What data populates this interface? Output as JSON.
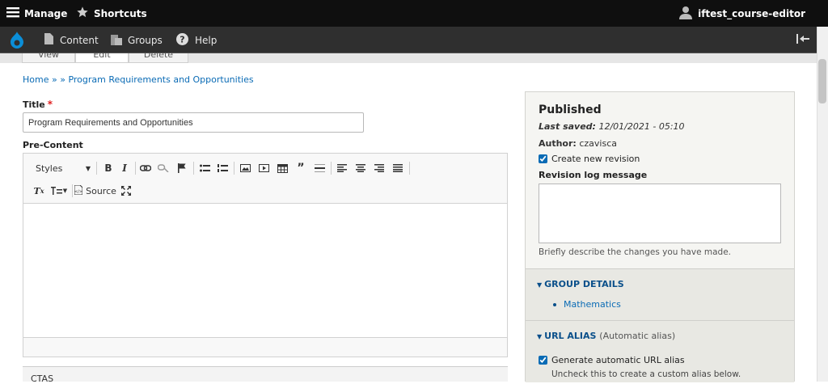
{
  "toolbar": {
    "manage_label": "Manage",
    "shortcuts_label": "Shortcuts",
    "user_label": "iftest_course-editor"
  },
  "secondary_toolbar": {
    "content_label": "Content",
    "groups_label": "Groups",
    "help_label": "Help"
  },
  "tabs": [
    {
      "label": "View"
    },
    {
      "label": "Edit"
    },
    {
      "label": "Delete"
    }
  ],
  "breadcrumb": {
    "home": "Home",
    "separator": "» »",
    "current": "Program Requirements and Opportunities"
  },
  "form": {
    "title_label": "Title",
    "title_required_marker": "*",
    "title_value": "Program Requirements and Opportunities",
    "precontent_label": "Pre-Content",
    "styles_label": "Styles",
    "source_label": "Source",
    "ctas_label": "CTAS"
  },
  "sidebar": {
    "status": "Published",
    "last_saved_label": "Last saved:",
    "last_saved_value": "12/01/2021 - 05:10",
    "author_label": "Author:",
    "author_value": "czavisca",
    "create_revision_label": "Create new revision",
    "create_revision_checked": true,
    "revision_log_label": "Revision log message",
    "revision_log_value": "",
    "revision_log_help": "Briefly describe the changes you have made.",
    "group_details_title": "GROUP DETAILS",
    "group_items": [
      "Mathematics"
    ],
    "url_alias_title": "URL ALIAS",
    "url_alias_note": "(Automatic alias)",
    "generate_alias_label": "Generate automatic URL alias",
    "generate_alias_checked": true,
    "generate_alias_help": "Uncheck this to create a custom alias below."
  },
  "colors": {
    "topbar": "#0f0f0f",
    "secbar": "#2f2f2f",
    "link": "#0a6bb5",
    "drupal_blue": "#0b8ed8",
    "required": "#e02020"
  }
}
